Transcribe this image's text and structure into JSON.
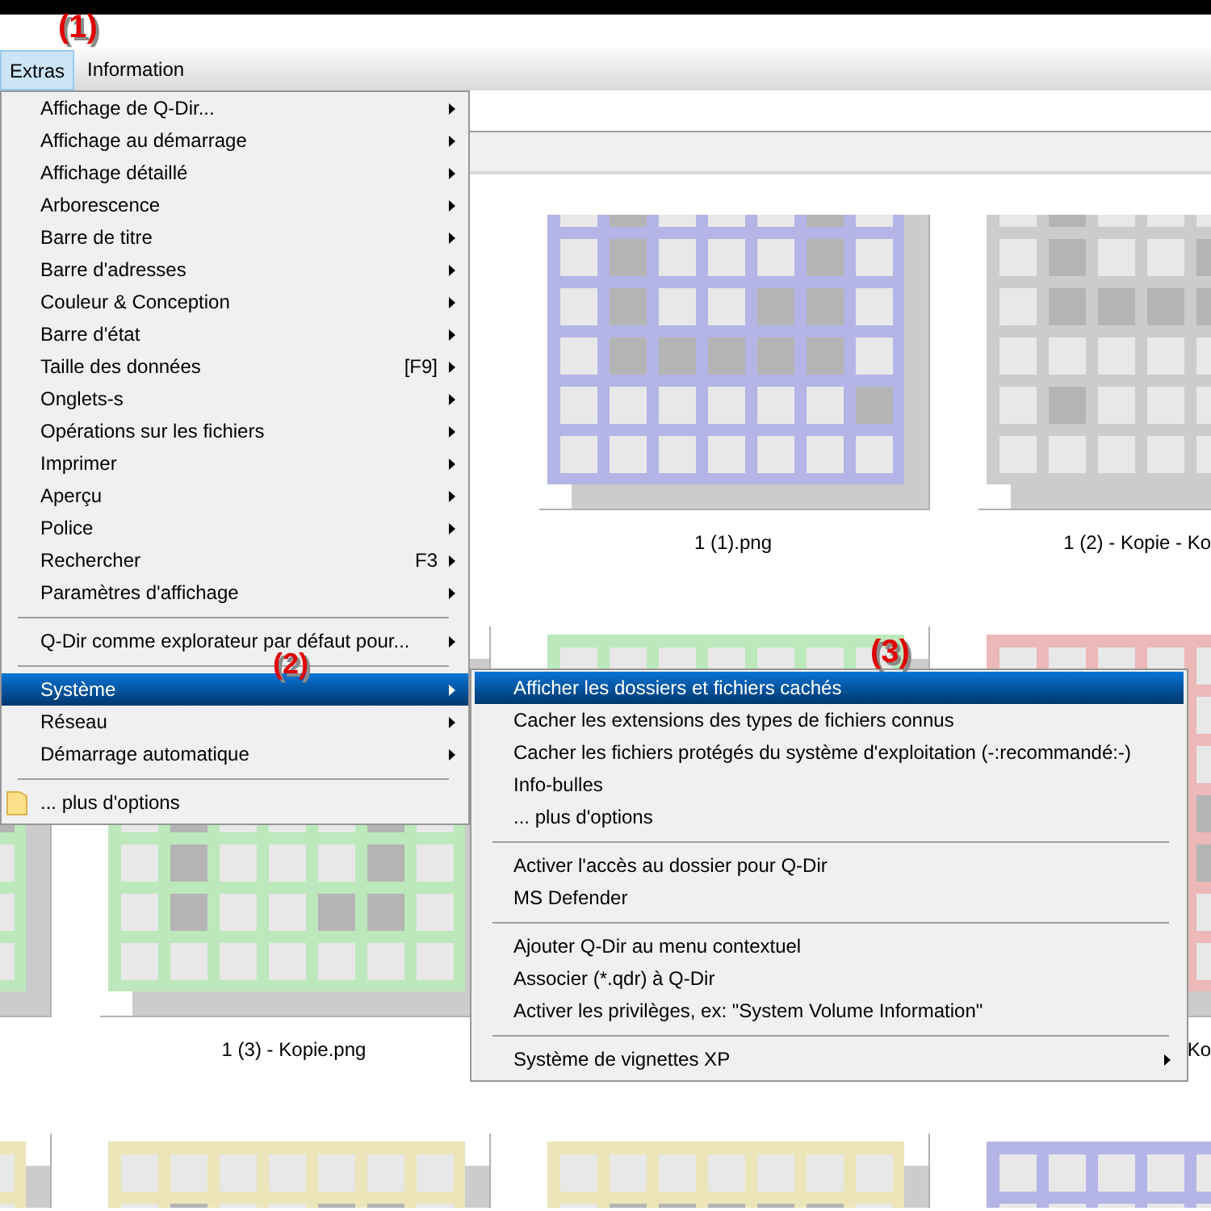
{
  "annotations": [
    {
      "label": "(1)"
    },
    {
      "label": "(2)"
    },
    {
      "label": "(3)"
    }
  ],
  "menubar": [
    {
      "label": "Extras",
      "selected": true
    },
    {
      "label": "Information",
      "selected": false
    }
  ],
  "menu": [
    {
      "kind": "item",
      "label": "Affichage de Q-Dir...",
      "submenu": true,
      "selected": false
    },
    {
      "kind": "item",
      "label": "Affichage au démarrage",
      "submenu": true,
      "selected": false
    },
    {
      "kind": "item",
      "label": "Affichage détaillé",
      "submenu": true,
      "selected": false
    },
    {
      "kind": "item",
      "label": "Arborescence",
      "submenu": true,
      "selected": false
    },
    {
      "kind": "item",
      "label": "Barre de titre",
      "submenu": true,
      "selected": false
    },
    {
      "kind": "item",
      "label": "Barre d'adresses",
      "submenu": true,
      "selected": false
    },
    {
      "kind": "item",
      "label": "Couleur & Conception",
      "submenu": true,
      "selected": false
    },
    {
      "kind": "item",
      "label": "Barre d'état",
      "submenu": true,
      "selected": false
    },
    {
      "kind": "item",
      "label": "Taille des données",
      "shortcut": "[F9]",
      "submenu": true,
      "selected": false
    },
    {
      "kind": "item",
      "label": "Onglets-s",
      "submenu": true,
      "selected": false
    },
    {
      "kind": "item",
      "label": "Opérations sur les fichiers",
      "submenu": true,
      "selected": false
    },
    {
      "kind": "item",
      "label": "Imprimer",
      "submenu": true,
      "selected": false
    },
    {
      "kind": "item",
      "label": "Aperçu",
      "submenu": true,
      "selected": false
    },
    {
      "kind": "item",
      "label": "Police",
      "submenu": true,
      "selected": false
    },
    {
      "kind": "item",
      "label": "Rechercher",
      "shortcut": "F3",
      "submenu": true,
      "selected": false
    },
    {
      "kind": "item",
      "label": "Paramètres d'affichage",
      "submenu": true,
      "selected": false
    },
    {
      "kind": "separator"
    },
    {
      "kind": "item",
      "label": "Q-Dir comme explorateur par défaut pour...",
      "submenu": true,
      "selected": false
    },
    {
      "kind": "separator"
    },
    {
      "kind": "item",
      "label": "Système",
      "submenu": true,
      "selected": true
    },
    {
      "kind": "item",
      "label": "Réseau",
      "submenu": true,
      "selected": false
    },
    {
      "kind": "item",
      "label": "Démarrage automatique",
      "submenu": true,
      "selected": false
    },
    {
      "kind": "separator"
    },
    {
      "kind": "icon_item",
      "label": "... plus d'options",
      "selected": false
    }
  ],
  "submenu": [
    {
      "kind": "item",
      "label": "Afficher les dossiers et fichiers cachés",
      "selected": true
    },
    {
      "kind": "item",
      "label": "Cacher les extensions des types de fichiers connus",
      "selected": false
    },
    {
      "kind": "item",
      "label": "Cacher les fichiers protégés du système d'exploitation (-:recommandé:-)",
      "selected": false
    },
    {
      "kind": "item",
      "label": "Info-bulles",
      "selected": false
    },
    {
      "kind": "item",
      "label": "... plus d'options",
      "selected": false
    },
    {
      "kind": "separator"
    },
    {
      "kind": "item",
      "label": "Activer l'accès au dossier pour Q-Dir",
      "selected": false
    },
    {
      "kind": "item",
      "label": "MS Defender",
      "selected": false
    },
    {
      "kind": "separator"
    },
    {
      "kind": "item",
      "label": "Ajouter Q-Dir au menu contextuel",
      "selected": false
    },
    {
      "kind": "item",
      "label": "Associer (*.qdr) à Q-Dir",
      "selected": false
    },
    {
      "kind": "item",
      "label": "Activer les privilèges, ex: \"System Volume Information\"",
      "selected": false
    },
    {
      "kind": "separator"
    },
    {
      "kind": "item",
      "label": "Système de vignettes XP",
      "submenu": true,
      "selected": false
    }
  ],
  "thumbnails": [
    [
      {
        "color": "#b4b4e6",
        "label": "1 (1).png"
      },
      {
        "color": "#cccccc",
        "label": "1 (2) - Kopie - Ko"
      }
    ],
    [
      {
        "color": "#bce8bc"
      },
      {
        "color": "#bce8bc",
        "label": "1 (3) - Kopie.png"
      },
      {
        "color": "#bce8bc"
      },
      {
        "color": "#ecb8b8",
        "label": "Ko"
      }
    ],
    [
      {
        "color": "#ebe5b9"
      },
      {
        "color": "#ebe5b9"
      },
      {
        "color": "#ebe5b9"
      },
      {
        "color": "#b4b4e6"
      }
    ]
  ]
}
